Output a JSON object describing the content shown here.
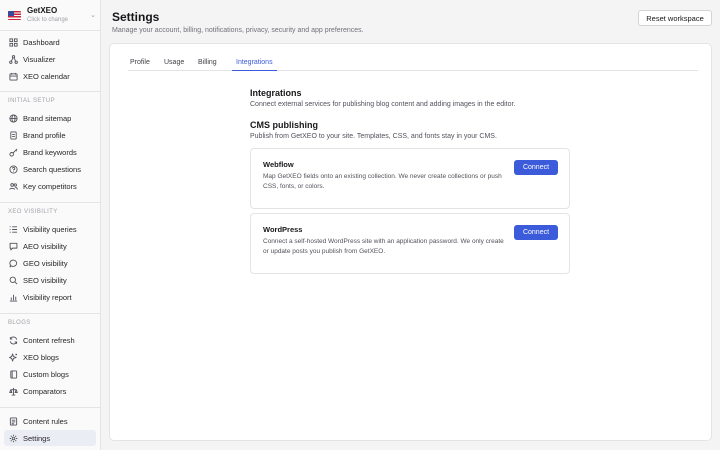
{
  "workspace": {
    "name": "GetXEO",
    "subtitle": "Click to change"
  },
  "sidebar": {
    "top_items": [
      {
        "label": "Dashboard",
        "icon": "grid-icon"
      },
      {
        "label": "Visualizer",
        "icon": "visualizer-icon"
      },
      {
        "label": "XEO calendar",
        "icon": "calendar-icon"
      }
    ],
    "sections": [
      {
        "label": "INITIAL SETUP",
        "items": [
          {
            "label": "Brand sitemap",
            "icon": "globe-icon"
          },
          {
            "label": "Brand profile",
            "icon": "document-icon"
          },
          {
            "label": "Brand keywords",
            "icon": "key-icon"
          },
          {
            "label": "Search questions",
            "icon": "help-circle-icon"
          },
          {
            "label": "Key competitors",
            "icon": "users-icon"
          }
        ]
      },
      {
        "label": "XEO VISIBILITY",
        "items": [
          {
            "label": "Visibility queries",
            "icon": "list-icon"
          },
          {
            "label": "AEO visibility",
            "icon": "chat-icon"
          },
          {
            "label": "GEO visibility",
            "icon": "bubble-icon"
          },
          {
            "label": "SEO visibility",
            "icon": "search-icon"
          },
          {
            "label": "Visibility report",
            "icon": "bar-chart-icon"
          }
        ]
      },
      {
        "label": "BLOGS",
        "items": [
          {
            "label": "Content refresh",
            "icon": "refresh-icon"
          },
          {
            "label": "XEO blogs",
            "icon": "sparkles-icon"
          },
          {
            "label": "Custom blogs",
            "icon": "book-icon"
          },
          {
            "label": "Comparators",
            "icon": "compare-icon"
          }
        ]
      }
    ],
    "bottom_items": [
      {
        "label": "Content rules",
        "icon": "rules-icon"
      },
      {
        "label": "Settings",
        "icon": "gear-icon",
        "active": true
      }
    ]
  },
  "header": {
    "title": "Settings",
    "subtitle": "Manage your account, billing, notifications, privacy, security and app preferences.",
    "reset_label": "Reset workspace"
  },
  "tabs": [
    {
      "label": "Profile"
    },
    {
      "label": "Usage"
    },
    {
      "label": "Billing"
    },
    {
      "label": "Integrations",
      "active": true
    }
  ],
  "integrations": {
    "heading": "Integrations",
    "description": "Connect external services for publishing blog content and adding images in the editor.",
    "cms_heading": "CMS publishing",
    "cms_description": "Publish from GetXEO to your site. Templates, CSS, and fonts stay in your CMS.",
    "cards": [
      {
        "title": "Webflow",
        "description": "Map GetXEO fields onto an existing collection. We never create collections or push CSS, fonts, or colors.",
        "button": "Connect"
      },
      {
        "title": "WordPress",
        "description": "Connect a self-hosted WordPress site with an application password. We only create or update posts you publish from GetXEO.",
        "button": "Connect"
      }
    ]
  },
  "colors": {
    "accent": "#3b5bdb",
    "active_nav_bg": "#ebedf5"
  }
}
